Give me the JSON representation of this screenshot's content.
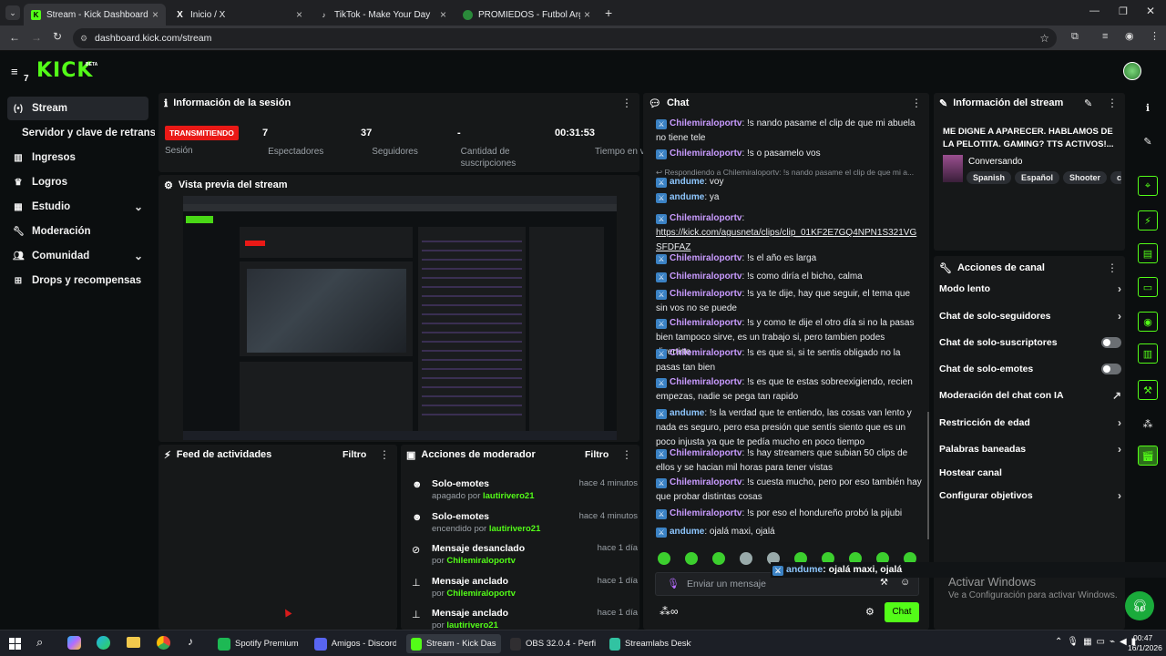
{
  "browser": {
    "tabs": [
      {
        "title": "Stream - Kick Dashboard",
        "icon": "kick-icon"
      },
      {
        "title": "Inicio / X",
        "icon": "x-icon"
      },
      {
        "title": "TikTok - Make Your Day",
        "icon": "tiktok-icon"
      },
      {
        "title": "PROMIEDOS - Futbol Argentino",
        "icon": "promiedos-icon"
      }
    ],
    "url": "dashboard.kick.com/stream"
  },
  "header": {
    "logo": "KICK",
    "logo_badge": "BETA",
    "notif_count": "7"
  },
  "sidebar": {
    "items": [
      {
        "label": "Stream",
        "icon": "broadcast-icon"
      },
      {
        "label": "Servidor y clave de retransm"
      },
      {
        "label": "Ingresos",
        "icon": "chart-icon"
      },
      {
        "label": "Logros",
        "icon": "trophy-icon"
      },
      {
        "label": "Estudio",
        "icon": "grid-icon"
      },
      {
        "label": "Moderación",
        "icon": "wrench-icon"
      },
      {
        "label": "Comunidad",
        "icon": "users-icon"
      },
      {
        "label": "Drops y recompensas",
        "icon": "gift-icon"
      }
    ]
  },
  "session": {
    "title": "Información de la sesión",
    "status": "TRANSMITIENDO",
    "status_label": "Sesión",
    "stats": [
      {
        "value": "7",
        "label": "Espectadores"
      },
      {
        "value": "37",
        "label": "Seguidores"
      },
      {
        "value": "-",
        "label": "Cantidad de suscripciones"
      },
      {
        "value": "00:31:53",
        "label": "Tiempo en vivo"
      }
    ]
  },
  "preview": {
    "title": "Vista previa del stream"
  },
  "activity": {
    "title": "Feed de actividades",
    "filter": "Filtro"
  },
  "modactions": {
    "title": "Acciones de moderador",
    "filter": "Filtro",
    "items": [
      {
        "title": "Solo-emotes",
        "sub": "apagado por",
        "user": "lautirivero21",
        "time": "hace 4 minutos",
        "icon": "emote-icon"
      },
      {
        "title": "Solo-emotes",
        "sub": "encendido por",
        "user": "lautirivero21",
        "time": "hace 4 minutos",
        "icon": "emote-icon"
      },
      {
        "title": "Mensaje desanclado",
        "sub": "por",
        "user": "Chilemiraloportv",
        "time": "hace 1 día",
        "icon": "unpin-icon"
      },
      {
        "title": "Mensaje anclado",
        "sub": "por",
        "user": "Chilemiraloportv",
        "time": "hace 1 día",
        "icon": "pin-icon"
      },
      {
        "title": "Mensaje anclado",
        "sub": "por",
        "user": "lautirivero21",
        "time": "hace 1 día",
        "icon": "pin-icon"
      }
    ]
  },
  "chat": {
    "title": "Chat",
    "messages": [
      {
        "user": "Chilemiraloportv",
        "text": ": !s nando pasame el clip de que mi abuela no tiene tele"
      },
      {
        "user": "Chilemiraloportv",
        "text": ": !s o pasamelo vos"
      },
      {
        "reply": "Respondiendo a Chilemiraloportv: !s nando pasame el clip de que mi a..."
      },
      {
        "user": "andume",
        "text": ": voy",
        "alt": true
      },
      {
        "user": "andume",
        "text": ": ya",
        "alt": true
      },
      {
        "user": "Chilemiraloportv",
        "text": ":",
        "link": "https://kick.com/agusneta/clips/clip_01KF2E7GQ4NPN1S321VGSFDFAZ"
      },
      {
        "user": "Chilemiraloportv",
        "text": ": !s el año es larga"
      },
      {
        "user": "Chilemiraloportv",
        "text": ": !s como diría el bicho, calma"
      },
      {
        "user": "Chilemiraloportv",
        "text": ": !s ya te dije, hay que seguir, el tema que sin vos no se puede"
      },
      {
        "user": "Chilemiraloportv",
        "text": ": !s y como te dije el otro día si no la pasas bien tampoco sirve, es un trabajo si, pero tambien podes divertirte"
      },
      {
        "user": "Chilemiraloportv",
        "text": ": !s es que si, si te sentis obligado no la pasas tan bien"
      },
      {
        "user": "Chilemiraloportv",
        "text": ": !s es que te estas sobreexigiendo, recien empezas, nadie se pega tan rapido"
      },
      {
        "user": "andume",
        "text": ": !s la verdad que te entiendo, las cosas van lento y nada es seguro, pero esa presión que sentís siento que es un poco injusta ya que te pedía mucho en poco tiempo",
        "alt": true
      },
      {
        "user": "Chilemiraloportv",
        "text": ": !s hay streamers que subian 50 clips de ellos y se hacian mil horas para tener vistas"
      },
      {
        "user": "Chilemiraloportv",
        "text": ": !s cuesta mucho, pero por eso también hay que probar distintas cosas"
      },
      {
        "user": "Chilemiraloportv",
        "text": ": !s por eso el hondureño probó la pijubi"
      },
      {
        "user": "andume",
        "text": ": ojalá maxi, ojalá",
        "alt": true
      }
    ],
    "input_placeholder": "Enviar un mensaje",
    "send": "Chat",
    "overlay_user": "andume",
    "overlay_text": ": ojalá maxi, ojalá"
  },
  "streaminfo": {
    "title": "Información del stream",
    "stream_title": "ME DIGNE A APARECER. HABLAMOS DE LA PELOTITA. GAMING? TTS ACTIVOS!...",
    "category": "Conversando",
    "tags": [
      "Spanish",
      "Español",
      "Shooter",
      "chill"
    ]
  },
  "channel_actions": {
    "title": "Acciones de canal",
    "items": [
      {
        "label": "Modo lento",
        "ctrl": "chevron"
      },
      {
        "label": "Chat de solo-seguidores",
        "ctrl": "chevron"
      },
      {
        "label": "Chat de solo-suscriptores",
        "ctrl": "toggle"
      },
      {
        "label": "Chat de solo-emotes",
        "ctrl": "toggle"
      },
      {
        "label": "Moderación del chat con IA",
        "ctrl": "external"
      },
      {
        "label": "Restricción de edad",
        "ctrl": "chevron"
      },
      {
        "label": "Palabras baneadas",
        "ctrl": "chevron"
      },
      {
        "label": "Hostear canal",
        "ctrl": "none"
      },
      {
        "label": "Configurar objetivos",
        "ctrl": "chevron"
      }
    ]
  },
  "watermark": {
    "line1": "Activar Windows",
    "line2": "Ve a Configuración para activar Windows."
  },
  "taskbar": {
    "apps": [
      {
        "label": "Spotify Premium",
        "color": "#1db954"
      },
      {
        "label": "Amigos - Discord",
        "color": "#5865f2"
      },
      {
        "label": "Stream - Kick Dash...",
        "color": "#53fc18"
      },
      {
        "label": "OBS 32.0.4 - Perfil:...",
        "color": "#302e31"
      },
      {
        "label": "Streamlabs Desktop",
        "color": "#31c3a2"
      }
    ],
    "time": "00:47",
    "date": "16/1/2026"
  },
  "colors": {
    "accent": "#53fc18",
    "live": "#e91916",
    "panel": "#161819",
    "bg": "#0b0e0f"
  }
}
